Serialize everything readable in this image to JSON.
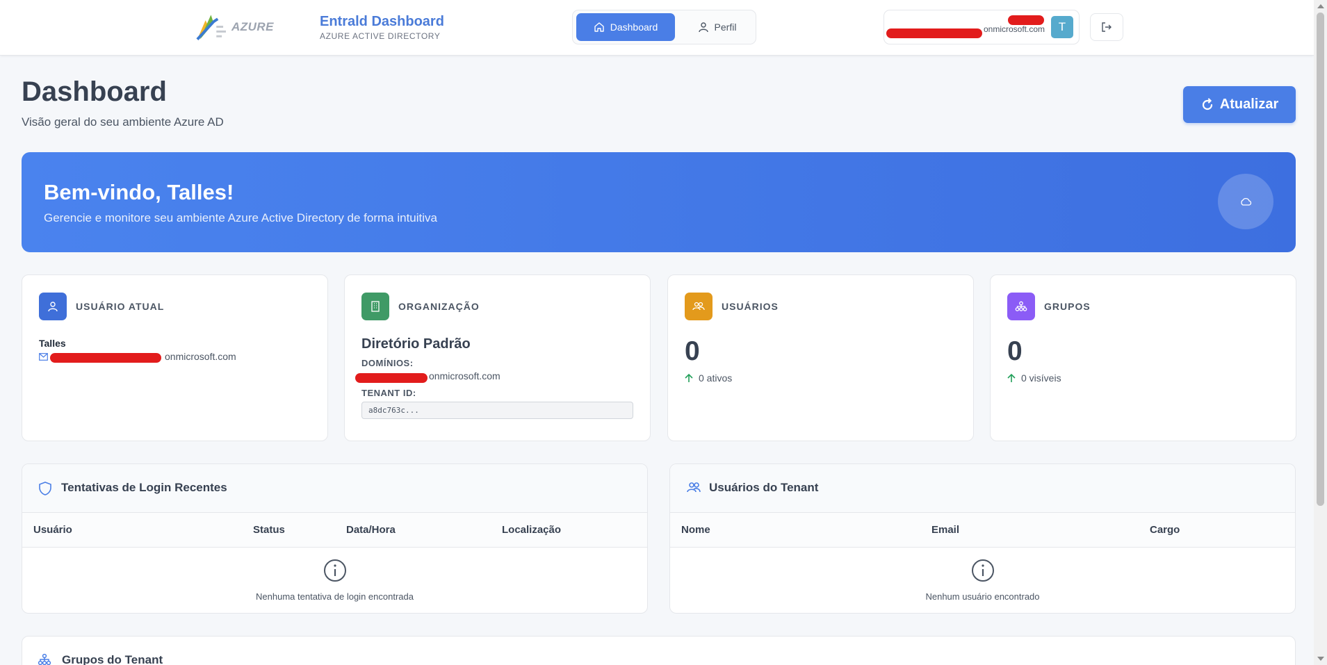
{
  "header": {
    "logo_text": "AZURE",
    "brand_title": "Entrald Dashboard",
    "brand_subtitle": "AZURE ACTIVE DIRECTORY",
    "nav": [
      {
        "label": "Dashboard",
        "active": true
      },
      {
        "label": "Perfil",
        "active": false
      }
    ],
    "user_email": "onmicrosoft.com",
    "avatar_initial": "T"
  },
  "page": {
    "title": "Dashboard",
    "subtitle": "Visão geral do seu ambiente Azure AD",
    "refresh_label": "Atualizar"
  },
  "hero": {
    "title": "Bem-vindo, Talles!",
    "subtitle": "Gerencie e monitore seu ambiente Azure Active Directory de forma intuitiva"
  },
  "cards": {
    "current_user": {
      "label": "USUÁRIO ATUAL",
      "name": "Talles",
      "email": "onmicrosoft.com",
      "icon_color": "#3f6fd9"
    },
    "organization": {
      "label": "ORGANIZAÇÃO",
      "name": "Diretório Padrão",
      "domains_label": "DOMÍNIOS:",
      "domain": "onmicrosoft.com",
      "tenant_label": "TENANT ID:",
      "tenant_id": "a8dc763c...",
      "icon_color": "#3f9a66"
    },
    "users": {
      "label": "USUÁRIOS",
      "count": "0",
      "trend": "0 ativos",
      "icon_color": "#e39a1c"
    },
    "groups": {
      "label": "GRUPOS",
      "count": "0",
      "trend": "0 visíveis",
      "icon_color": "#8b5cf6"
    }
  },
  "login_attempts": {
    "title": "Tentativas de Login Recentes",
    "columns": [
      "Usuário",
      "Status",
      "Data/Hora",
      "Localização"
    ],
    "empty_text": "Nenhuma tentativa de login encontrada"
  },
  "tenant_users": {
    "title": "Usuários do Tenant",
    "columns": [
      "Nome",
      "Email",
      "Cargo"
    ],
    "empty_text": "Nenhum usuário encontrado"
  },
  "tenant_groups": {
    "title": "Grupos do Tenant"
  },
  "colors": {
    "accent": "#4a7ee6",
    "trend_up": "#22a05a",
    "redaction": "#e21c1c"
  }
}
